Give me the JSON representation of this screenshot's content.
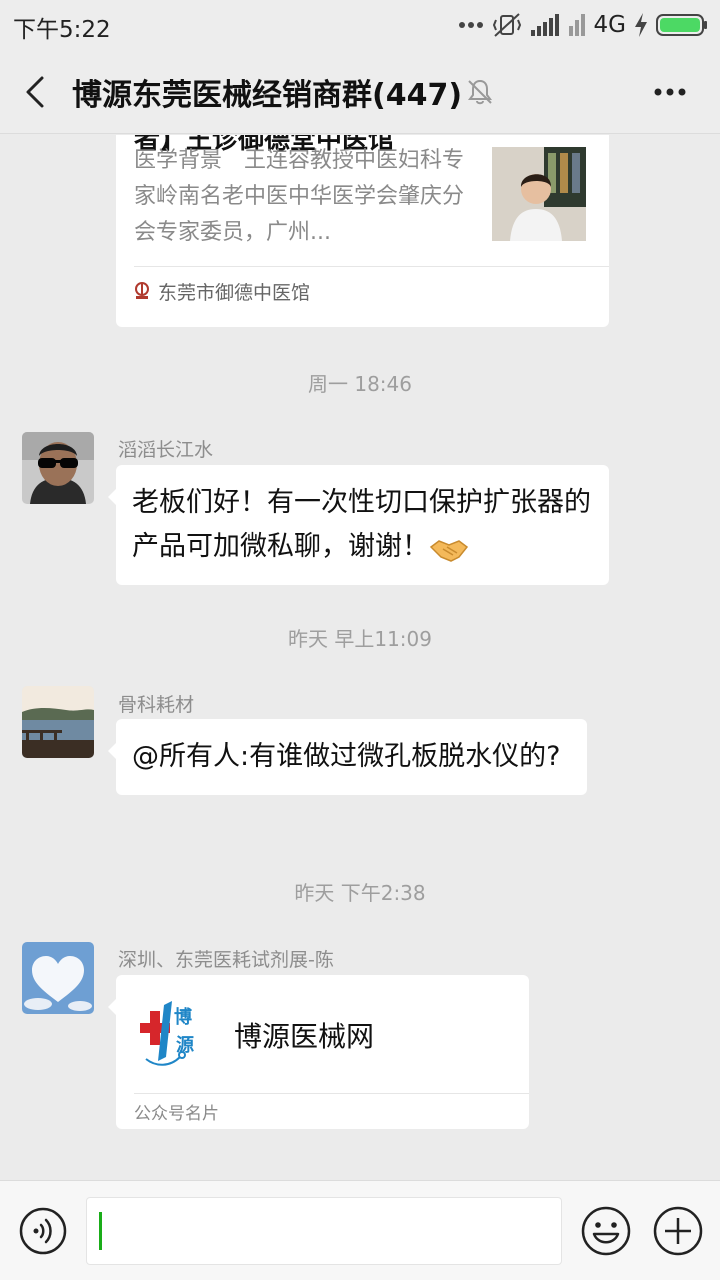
{
  "status_bar": {
    "time": "下午5:22",
    "network": "4G",
    "icons": [
      "more-dots-icon",
      "vibrate-off-icon",
      "signal-icon",
      "sim-signal-icon",
      "charging-icon",
      "battery-icon"
    ]
  },
  "header": {
    "title": "博源东莞医械经销商群(447)",
    "icons": [
      "back-icon",
      "mute-bell-icon",
      "more-icon"
    ]
  },
  "messages": [
    {
      "type": "article",
      "title_fragment": "者】王诊御德堂中医馆",
      "description": "医学背景　王连容教授中医妇科专家岭南名老中医中华医学会肇庆分会专家委员，广州...",
      "source": "东莞市御德中医馆"
    },
    {
      "type": "time",
      "text": "周一 18:46"
    },
    {
      "type": "text",
      "sender": "滔滔长江水",
      "text": "老板们好！有一次性切口保护扩张器的产品可加微私聊，谢谢！",
      "emoji": "handshake-icon"
    },
    {
      "type": "time",
      "text": "昨天 早上11:09"
    },
    {
      "type": "text",
      "sender": "骨科耗材",
      "text": "@所有人:有谁做过微孔板脱水仪的?"
    },
    {
      "type": "time",
      "text": "昨天 下午2:38"
    },
    {
      "type": "card",
      "sender": "深圳、东莞医耗试剂展-陈",
      "card_name": "博源医械网",
      "card_type": "公众号名片"
    }
  ],
  "input_bar": {
    "icons": [
      "voice-icon",
      "emoji-icon",
      "plus-icon"
    ]
  },
  "colors": {
    "background": "#ebebeb",
    "bar": "#ededed",
    "accent": "#1aad19",
    "bubble": "#ffffff"
  }
}
